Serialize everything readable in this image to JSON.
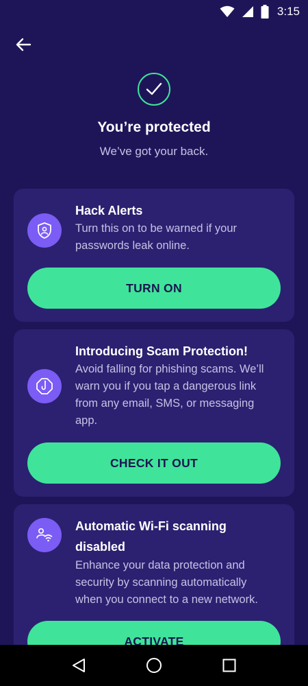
{
  "status_bar": {
    "time": "3:15",
    "icons": [
      "wifi-icon",
      "cell-signal-icon",
      "battery-icon"
    ]
  },
  "header": {
    "back_icon": "arrow-left-icon"
  },
  "hero": {
    "icon": "check-circle-icon",
    "title": "You’re protected",
    "subtitle": "We’ve got your back."
  },
  "cards": [
    {
      "icon": "shield-user-icon",
      "title": "Hack Alerts",
      "body_lines": [
        "Turn this on to be warned if your",
        "passwords leak online."
      ],
      "button_label": "TURN ON"
    },
    {
      "icon": "hook-octagon-icon",
      "title": "Introducing Scam Protection!",
      "body_lines": [
        "Avoid falling for phishing scams. We’ll",
        "warn you if you tap a dangerous link",
        "from any email, SMS, or messaging",
        "app."
      ],
      "button_label": "CHECK IT OUT"
    },
    {
      "icon": "wifi-user-icon",
      "title_lines": [
        "Automatic Wi-Fi scanning",
        "disabled"
      ],
      "body_lines": [
        "Enhance your data protection and",
        "security by scanning automatically",
        "when you connect to a new network."
      ],
      "button_label": "ACTIVATE"
    }
  ],
  "nav_bar": {
    "icons": [
      "back-triangle-icon",
      "home-circle-icon",
      "recents-square-icon"
    ]
  },
  "colors": {
    "background": "#1e1559",
    "card": "#2b2170",
    "accent_green": "#3fe49a",
    "icon_purple": "#7b5cf5",
    "muted_text": "#c6c2e6"
  }
}
